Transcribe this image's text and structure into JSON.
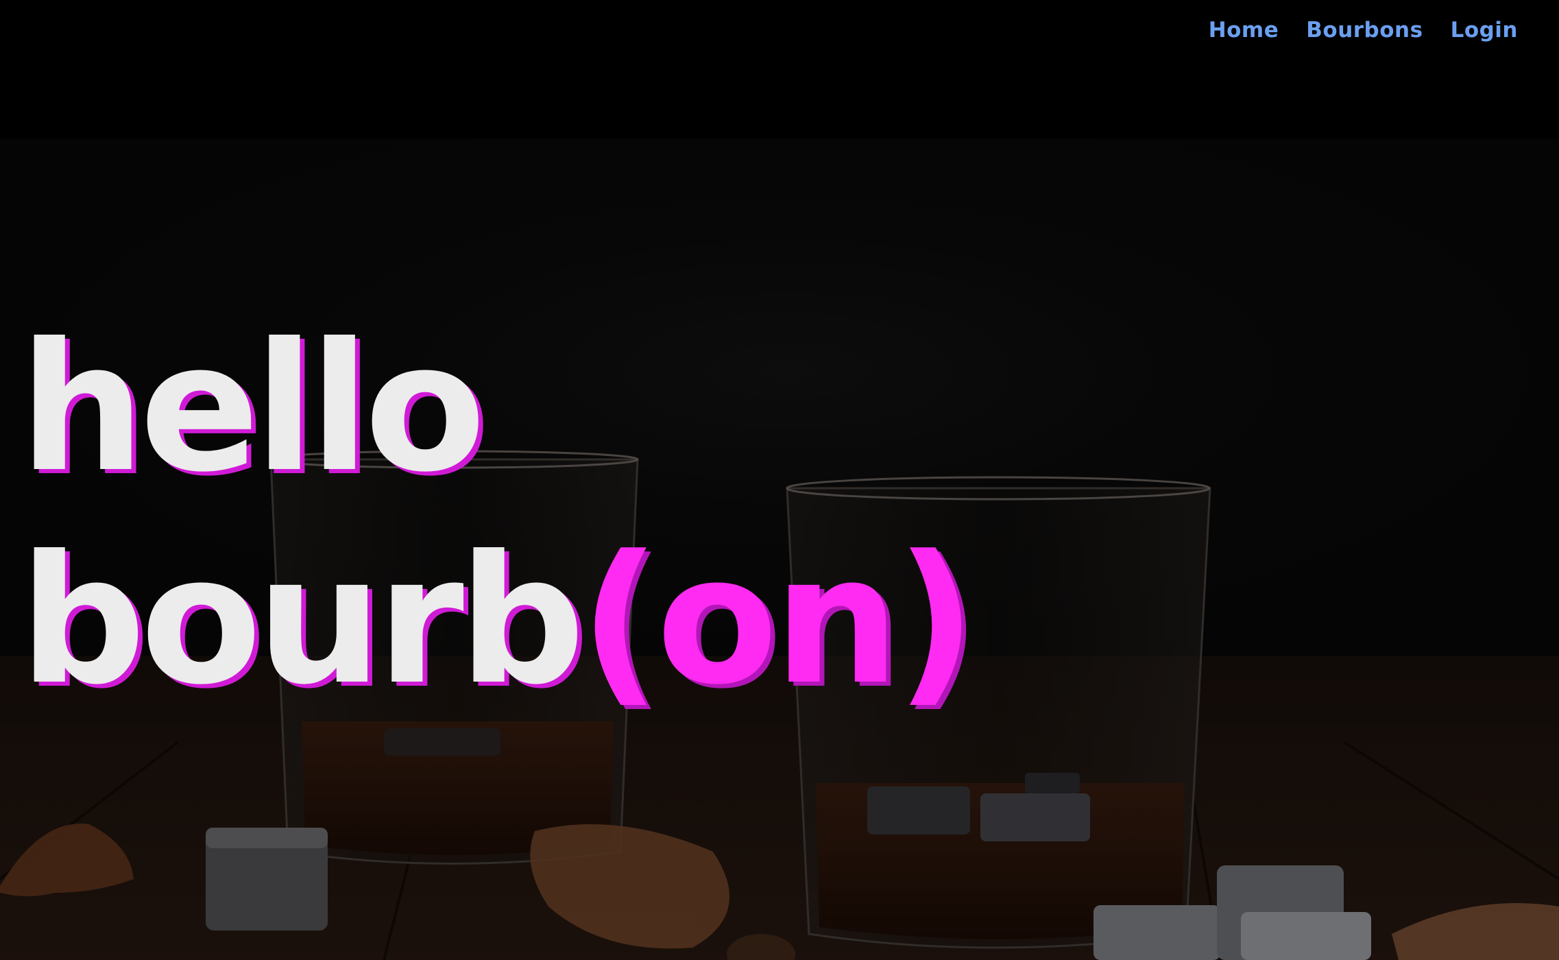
{
  "nav": {
    "items": [
      {
        "label": "Home"
      },
      {
        "label": "Bourbons"
      },
      {
        "label": "Login"
      }
    ]
  },
  "hero": {
    "line1": "hello",
    "line2_main": "bourb",
    "line2_accent": "(on)",
    "image": "bourbon-glasses-with-whiskey-stones-photo"
  },
  "colors": {
    "nav_link": "#6b9ff0",
    "headline": "#ececec",
    "accent": "#ff2bf2",
    "shadow": "#d01bd6",
    "background": "#000000"
  }
}
